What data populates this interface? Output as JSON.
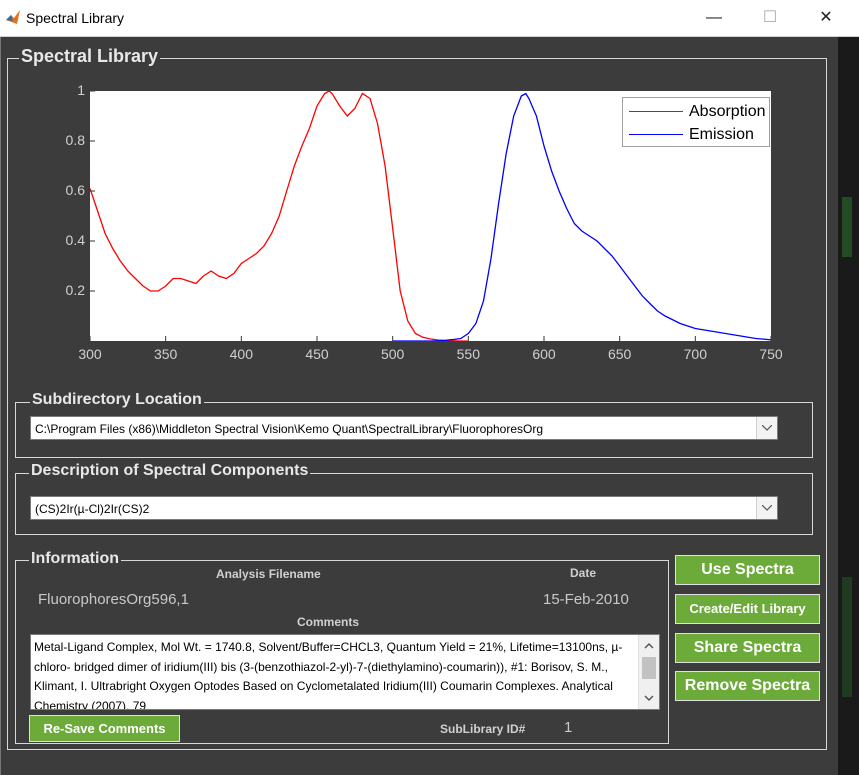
{
  "window": {
    "title": "Spectral Library",
    "minimize_glyph": "—",
    "maximize_glyph": "☐",
    "close_glyph": "✕"
  },
  "library_panel": {
    "title": "Spectral Library"
  },
  "chart_data": {
    "type": "line",
    "xlim": [
      300,
      750
    ],
    "ylim": [
      0,
      1
    ],
    "xticks": [
      "300",
      "350",
      "400",
      "450",
      "500",
      "550",
      "600",
      "650",
      "700",
      "750"
    ],
    "yticks": [
      "1",
      "0.8",
      "0.6",
      "0.4",
      "0.2"
    ],
    "legend_position": "top-right",
    "series": [
      {
        "name": "Absorption",
        "color": "#ff0000",
        "x": [
          300,
          305,
          310,
          315,
          320,
          325,
          330,
          335,
          340,
          345,
          350,
          355,
          360,
          365,
          370,
          375,
          380,
          385,
          390,
          395,
          400,
          405,
          410,
          415,
          420,
          425,
          430,
          435,
          440,
          445,
          450,
          455,
          458,
          460,
          465,
          470,
          475,
          480,
          485,
          490,
          495,
          500,
          505,
          510,
          515,
          520,
          525,
          530,
          535,
          540,
          545,
          550
        ],
        "y": [
          0.61,
          0.52,
          0.43,
          0.37,
          0.32,
          0.28,
          0.25,
          0.22,
          0.2,
          0.2,
          0.22,
          0.25,
          0.25,
          0.24,
          0.23,
          0.26,
          0.28,
          0.26,
          0.25,
          0.27,
          0.31,
          0.33,
          0.35,
          0.38,
          0.43,
          0.5,
          0.6,
          0.7,
          0.78,
          0.85,
          0.94,
          0.99,
          1.0,
          0.99,
          0.94,
          0.9,
          0.93,
          0.99,
          0.97,
          0.87,
          0.7,
          0.45,
          0.2,
          0.08,
          0.03,
          0.015,
          0.008,
          0.004,
          0.002,
          0.001,
          0.0,
          0.0
        ]
      },
      {
        "name": "Emission",
        "color": "#0000ff",
        "x": [
          500,
          505,
          510,
          515,
          520,
          525,
          530,
          535,
          540,
          545,
          550,
          555,
          560,
          565,
          570,
          575,
          580,
          585,
          588,
          590,
          595,
          600,
          605,
          610,
          615,
          620,
          625,
          630,
          635,
          640,
          645,
          650,
          655,
          660,
          665,
          670,
          675,
          680,
          690,
          700,
          710,
          720,
          730,
          740,
          750
        ],
        "y": [
          0.0,
          0.0,
          0.0,
          0.0,
          0.0,
          0.0,
          0.001,
          0.003,
          0.006,
          0.01,
          0.03,
          0.07,
          0.16,
          0.33,
          0.55,
          0.75,
          0.9,
          0.98,
          0.99,
          0.97,
          0.9,
          0.78,
          0.68,
          0.6,
          0.53,
          0.47,
          0.44,
          0.42,
          0.4,
          0.37,
          0.34,
          0.3,
          0.26,
          0.22,
          0.18,
          0.15,
          0.12,
          0.1,
          0.07,
          0.05,
          0.04,
          0.03,
          0.02,
          0.01,
          0.005
        ]
      }
    ]
  },
  "subdirectory": {
    "title": "Subdirectory Location",
    "value": "C:\\Program Files (x86)\\Middleton Spectral Vision\\Kemo Quant\\SpectralLibrary\\FluorophoresOrg"
  },
  "description": {
    "title": "Description of Spectral Components",
    "value": "(CS)2Ir(µ-Cl)2Ir(CS)2"
  },
  "information": {
    "title": "Information",
    "filename_label": "Analysis Filename",
    "filename_value": "FluorophoresOrg596,1",
    "date_label": "Date",
    "date_value": "15-Feb-2010",
    "comments_label": "Comments",
    "comments_text": "Metal-Ligand Complex, Mol Wt. = 1740.8, Solvent/Buffer=CHCL3, Quantum Yield = 21%, Lifetime=13100ns, µ-chloro- bridged dimer of iridium(III) bis (3-(benzothiazol-2-yl)-7-(diethylamino)-coumarin)), #1: Borisov, S. M., Klimant, I. Ultrabright Oxygen Optodes Based on Cyclometalated Iridium(III) Coumarin Complexes. Analytical Chemistry (2007), 79",
    "resave_label": "Re-Save Comments",
    "sublibrary_label": "SubLibrary ID#",
    "sublibrary_value": "1"
  },
  "actions": {
    "use_spectra": "Use Spectra",
    "create_edit": "Create/Edit Library",
    "share_spectra": "Share Spectra",
    "remove_spectra": "Remove Spectra"
  },
  "colors": {
    "background": "#3c3c3c",
    "button_green": "#6cab3a",
    "absorption": "#ff0000",
    "emission": "#0000ff"
  }
}
